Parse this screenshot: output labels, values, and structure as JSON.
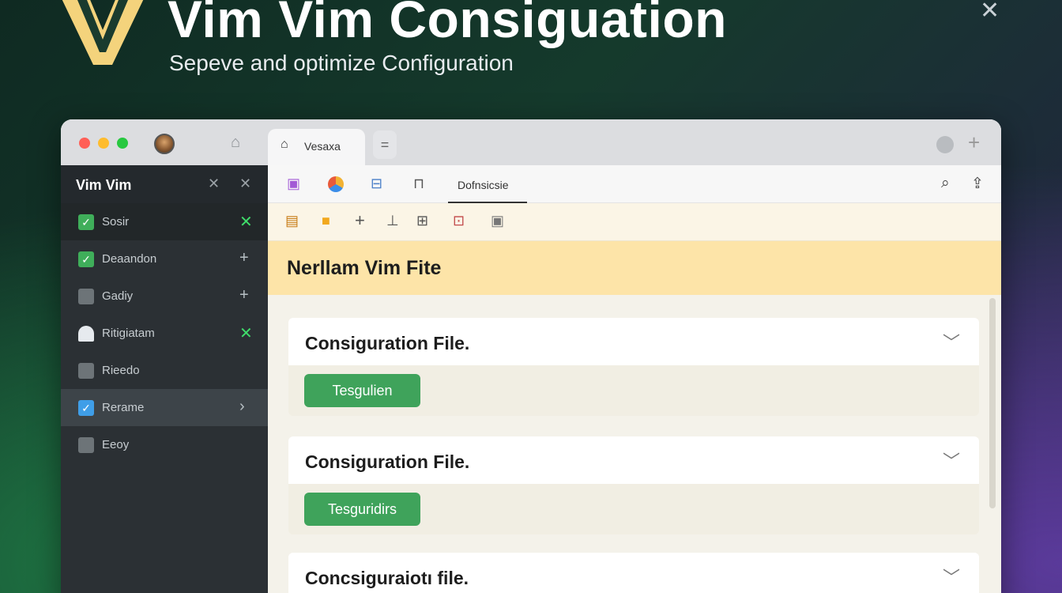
{
  "hero": {
    "title": "Vim Vim Consiguation",
    "subtitle": "Sepeve and optimize Configuration",
    "close_glyph": "✕",
    "colors": {
      "logo": "#f4d37c"
    }
  },
  "titlebar": {
    "home_glyph": "⌂",
    "active_tab_icon": "⌂",
    "active_tab_label": "Vesaxa",
    "tab_menu_glyph": "=",
    "new_tab_glyph": "+"
  },
  "sidebar": {
    "title": "Vim Vim",
    "header_icons": [
      "✕",
      "✕"
    ],
    "items": [
      {
        "label": "Sosir",
        "icon": "check-icon",
        "glyph": "✓",
        "icon_color": "#3fae5a",
        "action": "✕",
        "action_color": "#3fdc6a",
        "bg": "#222729"
      },
      {
        "label": "Deaandon",
        "icon": "check-icon",
        "glyph": "✓",
        "icon_color": "#3fae5a",
        "action": "+",
        "action_color": "#b8c0c5",
        "bg": "#2b3034"
      },
      {
        "label": "Gadiy",
        "icon": "box-icon",
        "glyph": "",
        "icon_color": "#6d7478",
        "action": "+",
        "action_color": "#b8c0c5",
        "bg": "#2b3034"
      },
      {
        "label": "Ritigiatam",
        "icon": "user-icon",
        "glyph": "",
        "icon_color": "#e6eaee",
        "action": "✕",
        "action_color": "#3fdc6a",
        "bg": "#2b3034"
      },
      {
        "label": "Rieedo",
        "icon": "doc-icon",
        "glyph": "",
        "icon_color": "#6d7478",
        "action": "",
        "action_color": "#b8c0c5",
        "bg": "#2b3034"
      },
      {
        "label": "Rerame",
        "icon": "check-icon",
        "glyph": "✓",
        "icon_color": "#3f9ee8",
        "action": "›",
        "action_color": "#b8c0c5",
        "bg": "#3d4449"
      },
      {
        "label": "Eeoy",
        "icon": "box-icon",
        "glyph": "",
        "icon_color": "#6d7478",
        "action": "",
        "action_color": "#b8c0c5",
        "bg": "#2b3034"
      }
    ]
  },
  "toolbar1": {
    "tab_label": "Dofnsicsie",
    "search_glyph": "⌕",
    "share_glyph": "⇪"
  },
  "toolbar2": {
    "add_glyph": "+"
  },
  "main": {
    "section_title": "Nerllam Vim Fite",
    "cards": [
      {
        "title": "Consiguration File.",
        "button": "Tesgulien",
        "chevron": "﹀"
      },
      {
        "title": "Consiguration File.",
        "button": "Tesguridirs",
        "chevron": "﹀"
      },
      {
        "title": "Concsiguraiotı file.",
        "button": "",
        "chevron": "﹀"
      }
    ]
  }
}
